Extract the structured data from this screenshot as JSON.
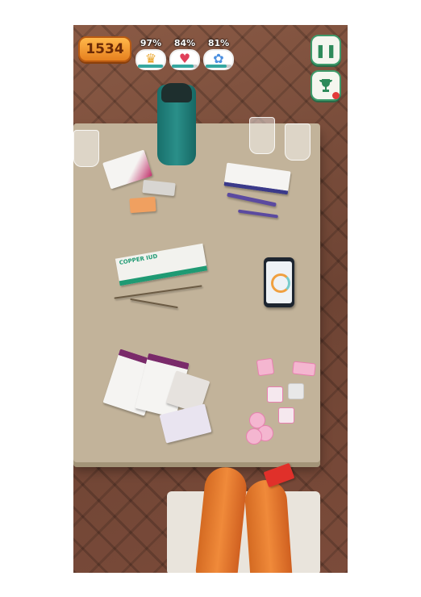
{
  "hud": {
    "coins": "1534",
    "stats": [
      {
        "name": "crown",
        "percent_label": "97%",
        "level": 0.97,
        "icon": "crown-icon",
        "glyph": "♛",
        "color": "#e8a020"
      },
      {
        "name": "heart",
        "percent_label": "84%",
        "level": 0.84,
        "icon": "heart-icon",
        "glyph": "♥",
        "color": "#e0405a"
      },
      {
        "name": "flower",
        "percent_label": "81%",
        "level": 0.81,
        "icon": "flower-icon",
        "glyph": "✿",
        "color": "#4a8fe0"
      }
    ],
    "pause_icon": "pause-icon",
    "trophy_icon": "trophy-icon"
  },
  "items": {
    "iud_box_label": "COPPER IUD"
  },
  "colors": {
    "accent_green": "#3e9a6a",
    "coin_orange": "#f0a030",
    "table": "#c2b39a",
    "notification": "#e23a3a"
  }
}
